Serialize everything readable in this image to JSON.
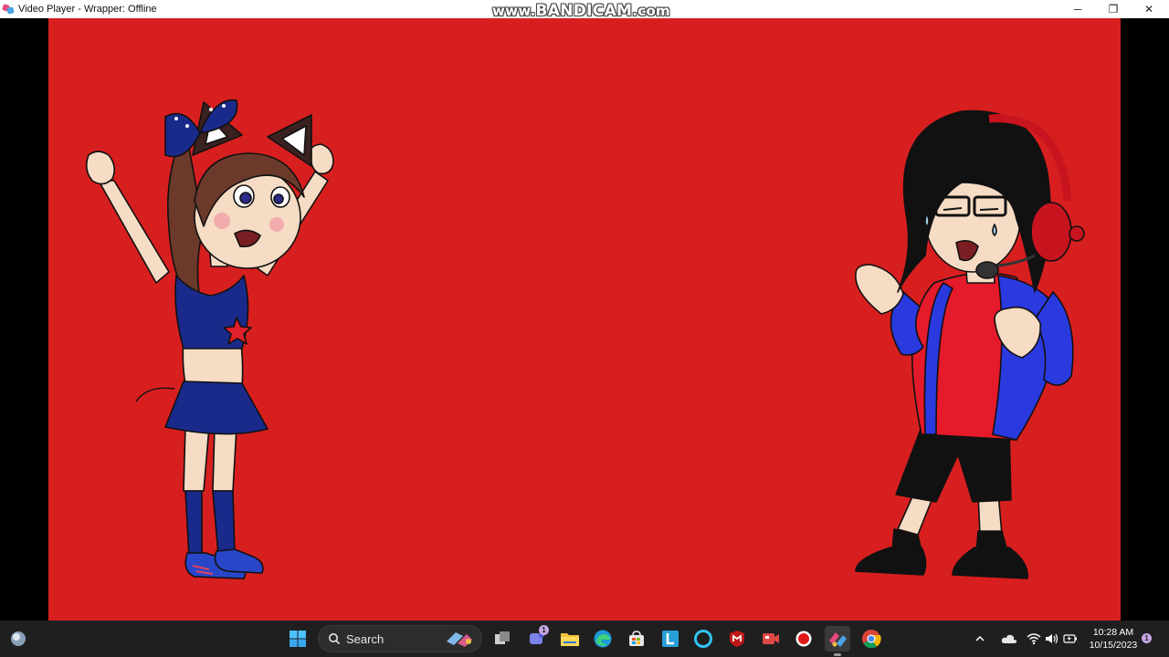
{
  "window": {
    "title": "Video Player - Wrapper: Offline",
    "watermark_prefix": "www.",
    "watermark_brand": "BANDICAM",
    "watermark_suffix": ".com",
    "controls": {
      "minimize": "─",
      "restore": "❐",
      "close": "✕"
    }
  },
  "scene": {
    "background_color": "#d81f1f",
    "characters": [
      {
        "name": "cat-girl-character"
      },
      {
        "name": "headset-boy-character"
      }
    ]
  },
  "taskbar": {
    "search_label": "Search",
    "pinned_apps": [
      {
        "icon": "start-icon"
      },
      {
        "icon": "widgets-icon"
      },
      {
        "icon": "task-view-icon"
      },
      {
        "icon": "teams-chat-icon",
        "badge": "1"
      },
      {
        "icon": "file-explorer-icon"
      },
      {
        "icon": "edge-icon"
      },
      {
        "icon": "store-icon"
      },
      {
        "icon": "l-app-icon"
      },
      {
        "icon": "alexa-icon"
      },
      {
        "icon": "mcafee-icon"
      },
      {
        "icon": "video-camera-icon"
      },
      {
        "icon": "record-icon"
      },
      {
        "icon": "wrapper-app-icon"
      },
      {
        "icon": "chrome-icon"
      }
    ],
    "tray": {
      "time": "10:28 AM",
      "date": "10/15/2023",
      "notification_count": "1"
    }
  }
}
